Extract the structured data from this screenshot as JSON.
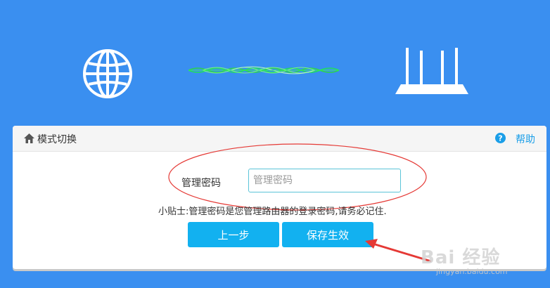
{
  "panel": {
    "title": "模式切换",
    "help_label": "帮助"
  },
  "form": {
    "password_label": "管理密码",
    "password_placeholder": "管理密码",
    "tip": "小贴士:管理密码是您管理路由器的登录密码,请务必记住."
  },
  "buttons": {
    "prev_label": "上一步",
    "save_label": "保存生效"
  },
  "watermark": {
    "brand": "Bai 经验",
    "url": "jingyan.baidu.com"
  },
  "colors": {
    "background": "#3a8ff0",
    "button": "#12b1f0",
    "help": "#1a9ee8",
    "annotation": "#e53935"
  },
  "icons": {
    "globe": "globe-icon",
    "router": "router-icon",
    "home": "home-icon",
    "help": "help-icon"
  }
}
